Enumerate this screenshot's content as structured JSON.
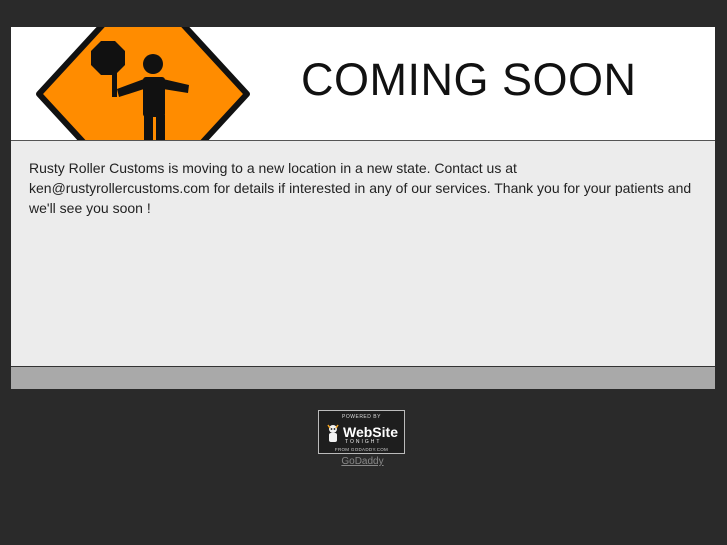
{
  "banner": {
    "title": "COMING SOON",
    "icon": "construction-flagger-sign-icon",
    "sign_color": "#ff8c00"
  },
  "content": {
    "message": "Rusty Roller Customs is moving to a new location in a new state. Contact us at ken@rustyrollercustoms.com for details if interested in any of our services. Thank you for your patients and we'll see you soon !"
  },
  "badge": {
    "top_text": "POWERED BY",
    "main_text": "WebSite",
    "sub_text": "TONIGHT",
    "bottom_text": "FROM GODADDY.COM"
  },
  "footer": {
    "link_text": "GoDaddy"
  },
  "colors": {
    "page_background": "#2a2a2a",
    "content_background": "#ececec",
    "footer_bar": "#a9a9a9"
  }
}
